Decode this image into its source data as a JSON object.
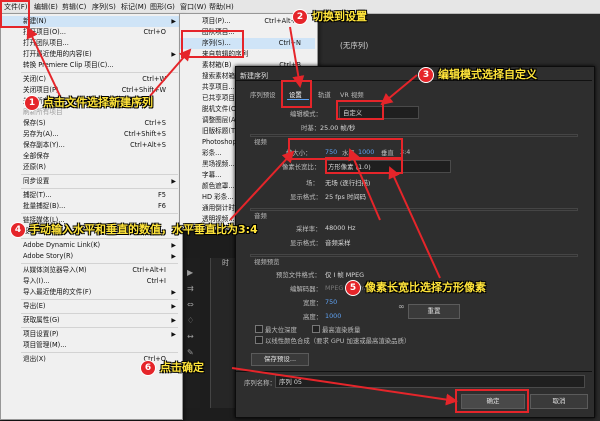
{
  "menubar": [
    "文件(F)",
    "编辑(E)",
    "剪辑(C)",
    "序列(S)",
    "标记(M)",
    "图形(G)",
    "窗口(W)",
    "帮助(H)"
  ],
  "file_menu": [
    {
      "label": "新建(N)",
      "shortcut": "",
      "submenu": true,
      "highlight": true
    },
    {
      "label": "打开项目(O)...",
      "shortcut": "Ctrl+O"
    },
    {
      "label": "打开团队项目...",
      "shortcut": ""
    },
    {
      "label": "打开最近使用的内容(E)",
      "shortcut": "",
      "submenu": true
    },
    {
      "label": "转换 Premiere Clip 项目(C)...",
      "shortcut": ""
    },
    {
      "sep": true
    },
    {
      "label": "关闭(C)",
      "shortcut": "Ctrl+W"
    },
    {
      "label": "关闭项目(P)",
      "shortcut": "Ctrl+Shift+W"
    },
    {
      "label": "关闭所有项目",
      "shortcut": ""
    },
    {
      "label": "刷新所有项目",
      "shortcut": "",
      "dim": true
    },
    {
      "label": "保存(S)",
      "shortcut": "Ctrl+S"
    },
    {
      "label": "另存为(A)...",
      "shortcut": "Ctrl+Shift+S"
    },
    {
      "label": "保存副本(Y)...",
      "shortcut": "Ctrl+Alt+S"
    },
    {
      "label": "全部保存",
      "shortcut": ""
    },
    {
      "label": "还原(R)",
      "shortcut": ""
    },
    {
      "sep": true
    },
    {
      "label": "同步设置",
      "shortcut": "",
      "submenu": true
    },
    {
      "sep": true
    },
    {
      "label": "捕捉(T)...",
      "shortcut": "F5"
    },
    {
      "label": "批量捕捉(B)...",
      "shortcut": "F6"
    },
    {
      "sep": true
    },
    {
      "label": "链接媒体(L)...",
      "shortcut": ""
    },
    {
      "label": "设为脱机(O)...",
      "shortcut": ""
    },
    {
      "sep": true
    },
    {
      "label": "Adobe Dynamic Link(K)",
      "shortcut": "",
      "submenu": true
    },
    {
      "label": "Adobe Story(R)",
      "shortcut": "",
      "submenu": true
    },
    {
      "sep": true
    },
    {
      "label": "从媒体浏览器导入(M)",
      "shortcut": "Ctrl+Alt+I"
    },
    {
      "label": "导入(I)...",
      "shortcut": "Ctrl+I"
    },
    {
      "label": "导入最近使用的文件(F)",
      "shortcut": "",
      "submenu": true
    },
    {
      "sep": true
    },
    {
      "label": "导出(E)",
      "shortcut": "",
      "submenu": true
    },
    {
      "sep": true
    },
    {
      "label": "获取属性(G)",
      "shortcut": "",
      "submenu": true
    },
    {
      "sep": true
    },
    {
      "label": "项目设置(P)",
      "shortcut": "",
      "submenu": true
    },
    {
      "label": "项目管理(M)...",
      "shortcut": ""
    },
    {
      "sep": true
    },
    {
      "label": "退出(X)",
      "shortcut": "Ctrl+Q"
    }
  ],
  "new_submenu": [
    {
      "label": "项目(P)...",
      "shortcut": "Ctrl+Alt+N"
    },
    {
      "label": "团队项目...",
      "shortcut": ""
    },
    {
      "label": "序列(S)...",
      "shortcut": "Ctrl+N",
      "highlight": true
    },
    {
      "label": "来自剪辑的序列",
      "shortcut": ""
    },
    {
      "label": "素材箱(B)",
      "shortcut": "Ctrl+B"
    },
    {
      "label": "搜索素材箱",
      "shortcut": ""
    },
    {
      "label": "共享项目...",
      "shortcut": ""
    },
    {
      "label": "已共享项目...",
      "shortcut": ""
    },
    {
      "label": "脱机文件(O)...",
      "shortcut": ""
    },
    {
      "label": "调整图层(A)...",
      "shortcut": ""
    },
    {
      "label": "旧版标题(T)...",
      "shortcut": ""
    },
    {
      "label": "Photoshop 文件(H)...",
      "shortcut": ""
    },
    {
      "label": "彩条...",
      "shortcut": ""
    },
    {
      "label": "黑场视频...",
      "shortcut": ""
    },
    {
      "label": "字幕...",
      "shortcut": ""
    },
    {
      "label": "颜色遮罩...",
      "shortcut": ""
    },
    {
      "label": "HD 彩条...",
      "shortcut": ""
    },
    {
      "label": "通用倒计时片头...",
      "shortcut": ""
    },
    {
      "label": "透明视频...",
      "shortcut": ""
    }
  ],
  "app": {
    "title_no_sequence": "(无序列)",
    "time_label": "时"
  },
  "dialog": {
    "title": "新建序列",
    "tabs": [
      "序列预设",
      "设置",
      "轨道",
      "VR 视频"
    ],
    "edit_mode_label": "编辑模式：",
    "edit_mode_value": "自定义",
    "timebase_label": "时基：",
    "timebase_value": "25.00 帧/秒",
    "video_section": "视频",
    "frame_size_label": "帧大小：",
    "frame_w": "750",
    "horizontal_label": "水平",
    "frame_h": "1000",
    "vertical_label": "垂直",
    "ratio": "3:4",
    "pixel_aspect_label": "像素长宽比：",
    "pixel_aspect_value": "方形像素 (1.0)",
    "field_label": "场：",
    "field_value": "无场 (逐行扫描)",
    "display_format_label": "显示格式：",
    "display_format_value": "25 fps 时间码",
    "audio_section": "音频",
    "sample_rate_label": "采样率：",
    "sample_rate_value": "48000 Hz",
    "audio_display_label": "显示格式：",
    "audio_display_value": "音频采样",
    "preview_section": "视频预览",
    "preview_format_label": "预览文件格式：",
    "preview_format_value": "仅 I 帧 MPEG",
    "codec_label": "编解码器：",
    "codec_value": "MPEG I-Frame",
    "width_label": "宽度：",
    "width_value": "750",
    "height_label": "高度：",
    "height_value": "1000",
    "reset_label": "重置",
    "max_bit_depth": "最大位深度",
    "max_render_quality": "最高渲染质量",
    "linear_color": "以线性颜色合成（要求 GPU 加速或最高渲染品质）",
    "save_preset": "保存预设...",
    "seq_name_label": "序列名称：",
    "seq_name_value": "序列 05",
    "ok": "确定",
    "cancel": "取消"
  },
  "annotations": [
    {
      "num": "1",
      "text": "点击文件选择新建序列"
    },
    {
      "num": "2",
      "text": "切换到设置"
    },
    {
      "num": "3",
      "text": "编辑模式选择自定义"
    },
    {
      "num": "4",
      "text": "手动输入水平和垂直的数值，水平垂直比为3:4"
    },
    {
      "num": "5",
      "text": "像素长宽比选择方形像素"
    },
    {
      "num": "6",
      "text": "点击确定"
    }
  ],
  "colors": {
    "annotation_red": "#e5252a",
    "annotation_text": "#ffe43a",
    "highlight": "#cfe4f7"
  }
}
